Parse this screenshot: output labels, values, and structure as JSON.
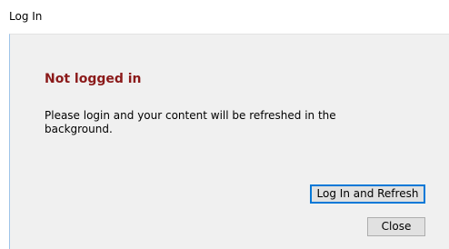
{
  "window": {
    "title": "Log In"
  },
  "content": {
    "heading": "Not logged in",
    "message": "Please login and your content will be refreshed in the background."
  },
  "buttons": {
    "login_refresh_label": "Log In and Refresh",
    "close_label": "Close"
  },
  "colors": {
    "heading": "#8b1a1a",
    "client_background": "#f0f0f0",
    "focus_border": "#0078d7",
    "window_border": "#9ec4e8"
  }
}
